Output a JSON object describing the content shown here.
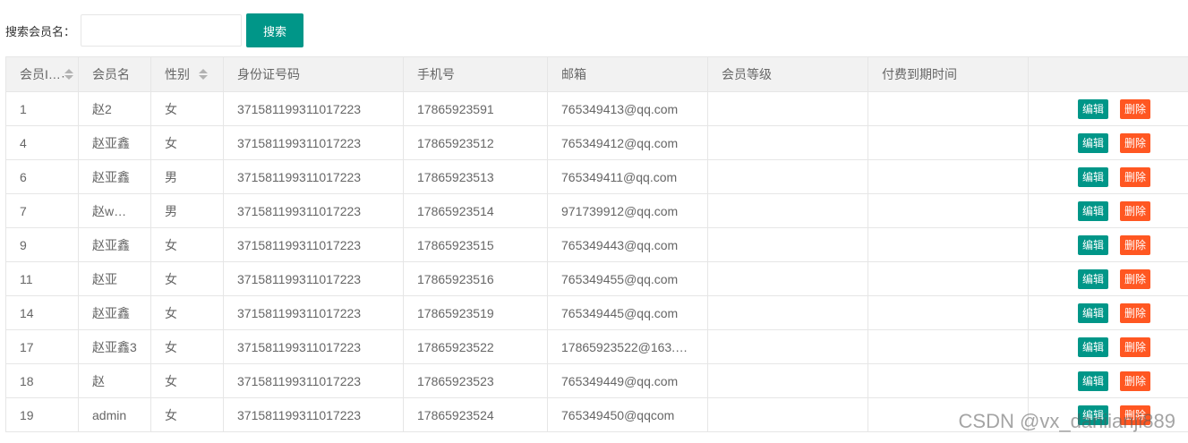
{
  "search": {
    "label": "搜索会员名：",
    "placeholder": "",
    "value": "",
    "button": "搜索"
  },
  "table": {
    "columns": [
      {
        "label": "会员I…",
        "sortable": true
      },
      {
        "label": "会员名",
        "sortable": false
      },
      {
        "label": "性别",
        "sortable": true
      },
      {
        "label": "身份证号码",
        "sortable": false
      },
      {
        "label": "手机号",
        "sortable": false
      },
      {
        "label": "邮箱",
        "sortable": false
      },
      {
        "label": "会员等级",
        "sortable": false
      },
      {
        "label": "付费到期时间",
        "sortable": false
      },
      {
        "label": "",
        "sortable": false
      }
    ],
    "edit_label": "编辑",
    "delete_label": "删除",
    "rows": [
      {
        "id": "1",
        "name": "赵2",
        "gender": "女",
        "idcard": "371581199311017223",
        "phone": "17865923591",
        "email": "765349413@qq.com",
        "level": "",
        "expire": ""
      },
      {
        "id": "4",
        "name": "赵亚鑫",
        "gender": "女",
        "idcard": "371581199311017223",
        "phone": "17865923512",
        "email": "765349412@qq.com",
        "level": "",
        "expire": ""
      },
      {
        "id": "6",
        "name": "赵亚鑫",
        "gender": "男",
        "idcard": "371581199311017223",
        "phone": "17865923513",
        "email": "765349411@qq.com",
        "level": "",
        "expire": ""
      },
      {
        "id": "7",
        "name": "赵w…",
        "gender": "男",
        "idcard": "371581199311017223",
        "phone": "17865923514",
        "email": "971739912@qq.com",
        "level": "",
        "expire": ""
      },
      {
        "id": "9",
        "name": "赵亚鑫",
        "gender": "女",
        "idcard": "371581199311017223",
        "phone": "17865923515",
        "email": "765349443@qq.com",
        "level": "",
        "expire": ""
      },
      {
        "id": "11",
        "name": "赵亚",
        "gender": "女",
        "idcard": "371581199311017223",
        "phone": "17865923516",
        "email": "765349455@qq.com",
        "level": "",
        "expire": ""
      },
      {
        "id": "14",
        "name": "赵亚鑫",
        "gender": "女",
        "idcard": "371581199311017223",
        "phone": "17865923519",
        "email": "765349445@qq.com",
        "level": "",
        "expire": ""
      },
      {
        "id": "17",
        "name": "赵亚鑫3",
        "gender": "女",
        "idcard": "371581199311017223",
        "phone": "17865923522",
        "email": "17865923522@163.…",
        "level": "",
        "expire": ""
      },
      {
        "id": "18",
        "name": "赵",
        "gender": "女",
        "idcard": "371581199311017223",
        "phone": "17865923523",
        "email": "765349449@qq.com",
        "level": "",
        "expire": ""
      },
      {
        "id": "19",
        "name": "admin",
        "gender": "女",
        "idcard": "371581199311017223",
        "phone": "17865923524",
        "email": "765349450@qqcom",
        "level": "",
        "expire": ""
      }
    ]
  },
  "watermark": "CSDN @vx_daniianji889",
  "colors": {
    "primary": "#009688",
    "danger": "#ff5722",
    "header_bg": "#f2f2f2",
    "border": "#e6e6e6"
  }
}
